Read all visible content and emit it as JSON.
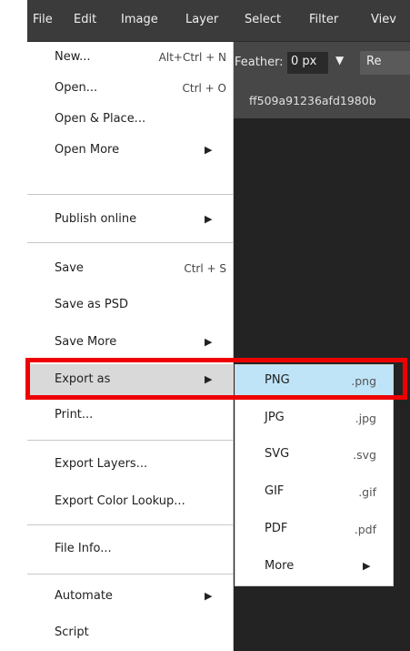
{
  "menubar": {
    "items": [
      {
        "label": "File"
      },
      {
        "label": "Edit"
      },
      {
        "label": "Image"
      },
      {
        "label": "Layer"
      },
      {
        "label": "Select"
      },
      {
        "label": "Filter"
      },
      {
        "label": "Viev"
      }
    ]
  },
  "options_bar": {
    "feather_label": "Feather:",
    "feather_value": "0 px",
    "refine_label": "Re"
  },
  "document_tab": {
    "title": "ff509a91236afd1980b"
  },
  "file_menu": {
    "items": [
      {
        "label": "New...",
        "shortcut": "Alt+Ctrl + N"
      },
      {
        "label": "Open...",
        "shortcut": "Ctrl + O"
      },
      {
        "label": "Open & Place..."
      },
      {
        "label": "Open More",
        "submenu": true
      },
      {
        "label": "Publish online",
        "submenu": true
      },
      {
        "label": "Save",
        "shortcut": "Ctrl + S"
      },
      {
        "label": "Save as PSD"
      },
      {
        "label": "Save More",
        "submenu": true
      },
      {
        "label": "Export as",
        "submenu": true,
        "active": true
      },
      {
        "label": "Print..."
      },
      {
        "label": "Export Layers..."
      },
      {
        "label": "Export Color Lookup..."
      },
      {
        "label": "File Info..."
      },
      {
        "label": "Automate",
        "submenu": true
      },
      {
        "label": "Script"
      }
    ]
  },
  "export_submenu": {
    "items": [
      {
        "label": "PNG",
        "ext": ".png",
        "highlighted": true
      },
      {
        "label": "JPG",
        "ext": ".jpg"
      },
      {
        "label": "SVG",
        "ext": ".svg"
      },
      {
        "label": "GIF",
        "ext": ".gif"
      },
      {
        "label": "PDF",
        "ext": ".pdf"
      },
      {
        "label": "More",
        "submenu": true
      }
    ]
  },
  "icons": {
    "submenu_arrow": "▶",
    "dropdown_arrow": "▼"
  },
  "colors": {
    "highlight_box": "#ee0000",
    "submenu_hover": "#bfe4f7",
    "menubar_bg": "#3b3b3b",
    "canvas_bg": "#232323"
  }
}
